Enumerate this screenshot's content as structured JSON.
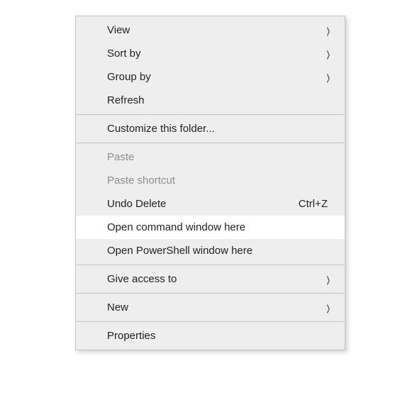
{
  "menu": {
    "items": [
      {
        "label": "View",
        "submenu": true
      },
      {
        "label": "Sort by",
        "submenu": true
      },
      {
        "label": "Group by",
        "submenu": true
      },
      {
        "label": "Refresh"
      },
      {
        "sep": true
      },
      {
        "label": "Customize this folder..."
      },
      {
        "sep": true
      },
      {
        "label": "Paste",
        "disabled": true
      },
      {
        "label": "Paste shortcut",
        "disabled": true
      },
      {
        "label": "Undo Delete",
        "shortcut": "Ctrl+Z"
      },
      {
        "label": "Open command window here",
        "highlight": true
      },
      {
        "label": "Open PowerShell window here"
      },
      {
        "sep": true
      },
      {
        "label": "Give access to",
        "submenu": true
      },
      {
        "sep": true
      },
      {
        "label": "New",
        "submenu": true
      },
      {
        "sep": true
      },
      {
        "label": "Properties"
      }
    ]
  }
}
